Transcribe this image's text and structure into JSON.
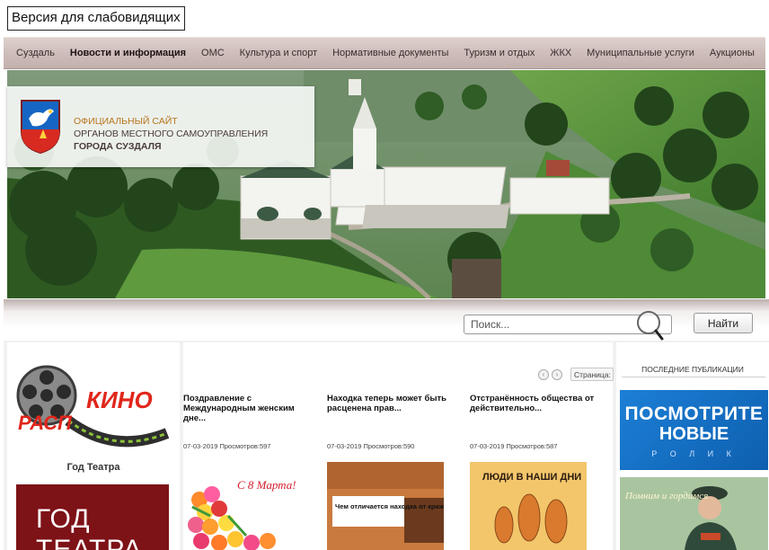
{
  "accessibility": {
    "label": "Версия для слабовидящих"
  },
  "nav": {
    "items": [
      {
        "label": "Суздаль"
      },
      {
        "label": "Новости и информация"
      },
      {
        "label": "ОМС"
      },
      {
        "label": "Культура и спорт"
      },
      {
        "label": "Нормативные документы"
      },
      {
        "label": "Туризм и отдых"
      },
      {
        "label": "ЖКХ"
      },
      {
        "label": "Муниципальные услуги"
      },
      {
        "label": "Аукционы"
      }
    ],
    "active_index": 1
  },
  "header": {
    "line1": "Официальный сайт",
    "line2": "органов местного самоуправления",
    "line3": "города Суздаля"
  },
  "search": {
    "placeholder": "Поиск...",
    "button_label": "Найти"
  },
  "left": {
    "kino_top": "КИНО",
    "kino_bottom": "РАСП",
    "caption": "Год Театра",
    "banner_line1": "ГОД",
    "banner_line2": "ТЕАТРА"
  },
  "pager": {
    "prev": "‹",
    "next": "›",
    "label": "Страница:"
  },
  "news": [
    {
      "title": "Поздравление с Международным женским дне...",
      "date": "07-03-2019",
      "views": "Просмотров:597",
      "thumb_text": "С 8 Марта!"
    },
    {
      "title": "Находка теперь может быть расценена прав...",
      "date": "07-03-2019",
      "views": "Просмотров:590",
      "thumb_text": "Чем отличается находка от кражи?"
    },
    {
      "title": "Отстранённость общества от действительно...",
      "date": "07-03-2019",
      "views": "Просмотров:587",
      "thumb_text": "ЛЮДИ В НАШИ ДНИ"
    }
  ],
  "recent": {
    "header": "Последние публикации",
    "banner_line1": "ПОСМОТРИТЕ",
    "banner_line2": "НОВЫЕ",
    "banner_line3": "Р О Л И К",
    "photo_caption": "Помним и гордимся"
  },
  "colors": {
    "nav_bg": "#cdbcb9",
    "theatre_red": "#7d1217",
    "recent_blue": "#1c7fd6",
    "logo_gold": "#b7761e"
  }
}
